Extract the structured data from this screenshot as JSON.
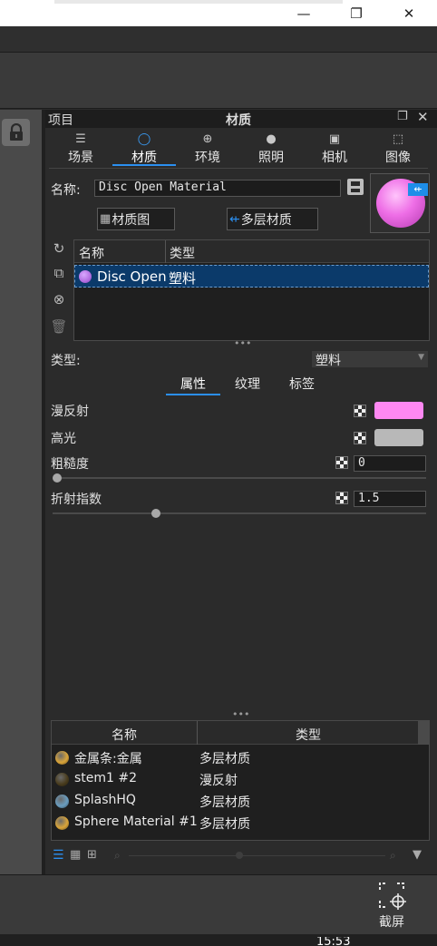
{
  "window": {
    "minimize_glyph": "—",
    "maximize_glyph": "❐",
    "close_glyph": "✕"
  },
  "panel": {
    "project_label": "项目",
    "title": "材质"
  },
  "tabs": [
    {
      "label": "场景",
      "icon": "list-icon"
    },
    {
      "label": "材质",
      "icon": "material-ball-icon"
    },
    {
      "label": "环境",
      "icon": "globe-icon"
    },
    {
      "label": "照明",
      "icon": "bulb-icon"
    },
    {
      "label": "相机",
      "icon": "camera-icon"
    },
    {
      "label": "图像",
      "icon": "frame-icon"
    }
  ],
  "material": {
    "name_label": "名称:",
    "name_value": "Disc Open Material",
    "graph_button": "材质图",
    "multilayer_button": "多层材质",
    "preview_color": "#ee6ee6"
  },
  "list": {
    "col_name": "名称",
    "col_type": "类型",
    "selected_name": "Disc Open",
    "selected_type": "塑料",
    "selected_icon_color": "#b26de0"
  },
  "type_row": {
    "label": "类型:",
    "value": "塑料"
  },
  "subtabs": [
    "属性",
    "纹理",
    "标签"
  ],
  "props": {
    "diffuse_label": "漫反射",
    "diffuse_color": "#ff88f2",
    "specular_label": "高光",
    "specular_color": "#b8b8b8",
    "roughness_label": "粗糙度",
    "roughness_value": "0",
    "roughness_fraction": 0.0,
    "ior_label": "折射指数",
    "ior_value": "1.5",
    "ior_fraction": 0.27
  },
  "library": {
    "col_name": "名称",
    "col_type": "类型",
    "rows": [
      {
        "name": "金属条:金属",
        "type": "多层材质",
        "icon_color": "#d9a43a"
      },
      {
        "name": "stem1  #2",
        "type": "漫反射",
        "icon_color": "#4a3d1e"
      },
      {
        "name": "SplashHQ",
        "type": "多层材质",
        "icon_color": "#6a9dbf"
      },
      {
        "name": "Sphere Material #1",
        "type": "多层材质",
        "icon_color": "#d9a43a"
      }
    ]
  },
  "statusbar": {
    "screenshot_label": "截屏",
    "clock": "15:53"
  },
  "colors": {
    "accent": "#2b8ff0",
    "selection": "#0b3a6a"
  }
}
